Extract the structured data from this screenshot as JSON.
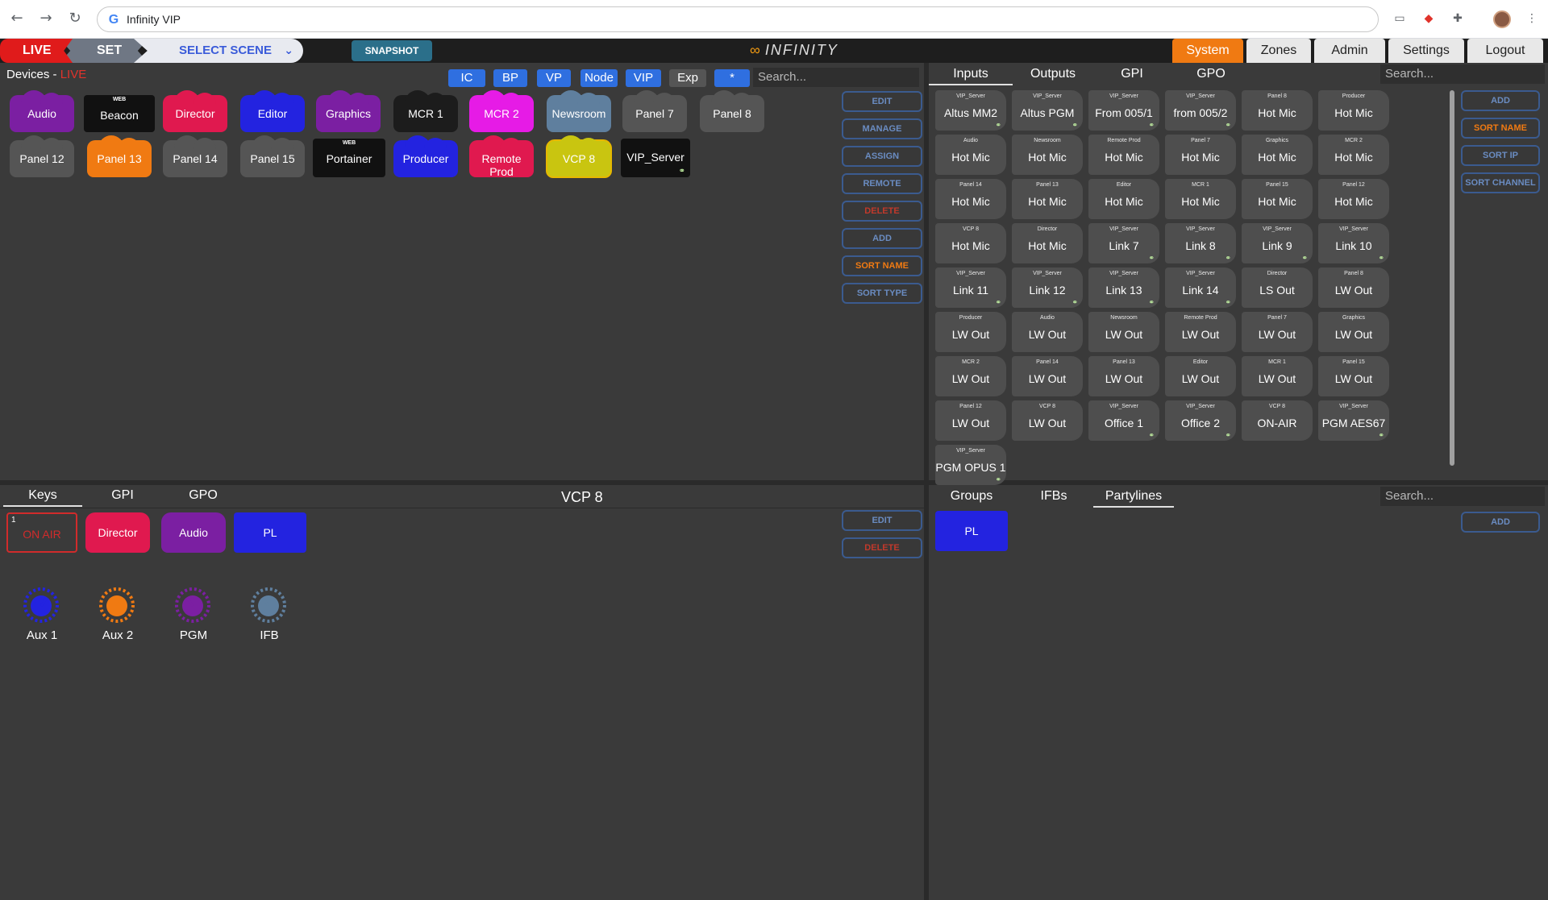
{
  "browser": {
    "page_title": "Infinity VIP",
    "back": "←",
    "forward": "→",
    "reload": "↻"
  },
  "appbar": {
    "live": "LIVE",
    "set": "SET",
    "scene": "SELECT SCENE",
    "snapshot": "SNAPSHOT",
    "logo": "INFINITY",
    "tabs": [
      "System",
      "Zones",
      "Admin",
      "Settings",
      "Logout"
    ]
  },
  "devices": {
    "title": "Devices - ",
    "title_status": "LIVE",
    "filters": [
      "IC",
      "BP",
      "VP",
      "Node",
      "VIP",
      "Exp",
      "*"
    ],
    "search_placeholder": "Search...",
    "items": [
      {
        "label": "Audio",
        "color": "#7b1fa2"
      },
      {
        "label": "Beacon",
        "tag": "WEB",
        "color": "#111111"
      },
      {
        "label": "Director",
        "color": "#e0194f"
      },
      {
        "label": "Editor",
        "color": "#2323e0"
      },
      {
        "label": "Graphics",
        "color": "#7b1fa2"
      },
      {
        "label": "MCR 1",
        "color": "#1c1c1c"
      },
      {
        "label": "MCR 2",
        "color": "#e61be6"
      },
      {
        "label": "Newsroom",
        "color": "#5f7f9e"
      },
      {
        "label": "Panel 7",
        "color": "#555555"
      },
      {
        "label": "Panel 8",
        "color": "#555555"
      },
      {
        "label": "Panel 12",
        "color": "#555555"
      },
      {
        "label": "Panel 13",
        "color": "#f07a12"
      },
      {
        "label": "Panel 14",
        "color": "#555555"
      },
      {
        "label": "Panel 15",
        "color": "#555555"
      },
      {
        "label": "Portainer",
        "tag": "WEB",
        "color": "#111111"
      },
      {
        "label": "Producer",
        "color": "#2323e0"
      },
      {
        "label": "Remote Prod",
        "color": "#e0194f"
      },
      {
        "label": "VCP 8",
        "color": "#c9c510"
      },
      {
        "label": "VIP_Server",
        "color": "#111111"
      }
    ],
    "buttons": [
      "EDIT",
      "MANAGE",
      "ASSIGN",
      "REMOTE",
      "DELETE",
      "ADD",
      "SORT NAME",
      "SORT TYPE"
    ]
  },
  "io": {
    "tabs": [
      "Inputs",
      "Outputs",
      "GPI",
      "GPO"
    ],
    "search_placeholder": "Search...",
    "buttons": [
      "ADD",
      "SORT NAME",
      "SORT IP",
      "SORT CHANNEL"
    ],
    "items": [
      {
        "small": "VIP_Server",
        "big": "Altus MM2",
        "link": true
      },
      {
        "small": "VIP_Server",
        "big": "Altus PGM",
        "link": true
      },
      {
        "small": "VIP_Server",
        "big": "From 005/1",
        "link": true
      },
      {
        "small": "VIP_Server",
        "big": "from 005/2",
        "link": true
      },
      {
        "small": "Panel 8",
        "big": "Hot Mic"
      },
      {
        "small": "Producer",
        "big": "Hot Mic"
      },
      {
        "small": "Audio",
        "big": "Hot Mic"
      },
      {
        "small": "Newsroom",
        "big": "Hot Mic"
      },
      {
        "small": "Remote Prod",
        "big": "Hot Mic"
      },
      {
        "small": "Panel 7",
        "big": "Hot Mic"
      },
      {
        "small": "Graphics",
        "big": "Hot Mic"
      },
      {
        "small": "MCR 2",
        "big": "Hot Mic"
      },
      {
        "small": "Panel 14",
        "big": "Hot Mic"
      },
      {
        "small": "Panel 13",
        "big": "Hot Mic"
      },
      {
        "small": "Editor",
        "big": "Hot Mic"
      },
      {
        "small": "MCR 1",
        "big": "Hot Mic"
      },
      {
        "small": "Panel 15",
        "big": "Hot Mic"
      },
      {
        "small": "Panel 12",
        "big": "Hot Mic"
      },
      {
        "small": "VCP 8",
        "big": "Hot Mic"
      },
      {
        "small": "Director",
        "big": "Hot Mic"
      },
      {
        "small": "VIP_Server",
        "big": "Link 7",
        "link": true
      },
      {
        "small": "VIP_Server",
        "big": "Link 8",
        "link": true
      },
      {
        "small": "VIP_Server",
        "big": "Link 9",
        "link": true
      },
      {
        "small": "VIP_Server",
        "big": "Link 10",
        "link": true
      },
      {
        "small": "VIP_Server",
        "big": "Link 11",
        "link": true
      },
      {
        "small": "VIP_Server",
        "big": "Link 12",
        "link": true
      },
      {
        "small": "VIP_Server",
        "big": "Link 13",
        "link": true
      },
      {
        "small": "VIP_Server",
        "big": "Link 14",
        "link": true
      },
      {
        "small": "Director",
        "big": "LS Out"
      },
      {
        "small": "Panel 8",
        "big": "LW Out"
      },
      {
        "small": "Producer",
        "big": "LW Out"
      },
      {
        "small": "Audio",
        "big": "LW Out"
      },
      {
        "small": "Newsroom",
        "big": "LW Out"
      },
      {
        "small": "Remote Prod",
        "big": "LW Out"
      },
      {
        "small": "Panel 7",
        "big": "LW Out"
      },
      {
        "small": "Graphics",
        "big": "LW Out"
      },
      {
        "small": "MCR 2",
        "big": "LW Out"
      },
      {
        "small": "Panel 14",
        "big": "LW Out"
      },
      {
        "small": "Panel 13",
        "big": "LW Out"
      },
      {
        "small": "Editor",
        "big": "LW Out"
      },
      {
        "small": "MCR 1",
        "big": "LW Out"
      },
      {
        "small": "Panel 15",
        "big": "LW Out"
      },
      {
        "small": "Panel 12",
        "big": "LW Out"
      },
      {
        "small": "VCP 8",
        "big": "LW Out"
      },
      {
        "small": "VIP_Server",
        "big": "Office 1",
        "link": true
      },
      {
        "small": "VIP_Server",
        "big": "Office 2",
        "link": true
      },
      {
        "small": "VCP 8",
        "big": "ON-AIR"
      },
      {
        "small": "VIP_Server",
        "big": "PGM AES67",
        "link": true
      },
      {
        "small": "VIP_Server",
        "big": "PGM OPUS 1",
        "link": true
      }
    ]
  },
  "keys_panel": {
    "tabs": [
      "Keys",
      "GPI",
      "GPO"
    ],
    "title": "VCP 8",
    "buttons": [
      "EDIT",
      "DELETE"
    ],
    "keys": [
      {
        "num": "1",
        "label": "ON AIR",
        "kind": "onair",
        "color": "#d12b2b"
      },
      {
        "label": "Director",
        "kind": "cloud",
        "color": "#e0194f"
      },
      {
        "label": "Audio",
        "kind": "cloud",
        "color": "#7b1fa2"
      },
      {
        "label": "PL",
        "kind": "square",
        "color": "#2323e0"
      }
    ],
    "knobs": [
      {
        "label": "Aux 1",
        "color": "#2323e0"
      },
      {
        "label": "Aux 2",
        "color": "#f07a12"
      },
      {
        "label": "PGM",
        "color": "#7b1fa2"
      },
      {
        "label": "IFB",
        "color": "#5f7f9e"
      }
    ]
  },
  "groups_panel": {
    "tabs": [
      "Groups",
      "IFBs",
      "Partylines"
    ],
    "search_placeholder": "Search...",
    "add": "ADD",
    "items": [
      {
        "label": "PL",
        "color": "#2323e0"
      }
    ]
  }
}
